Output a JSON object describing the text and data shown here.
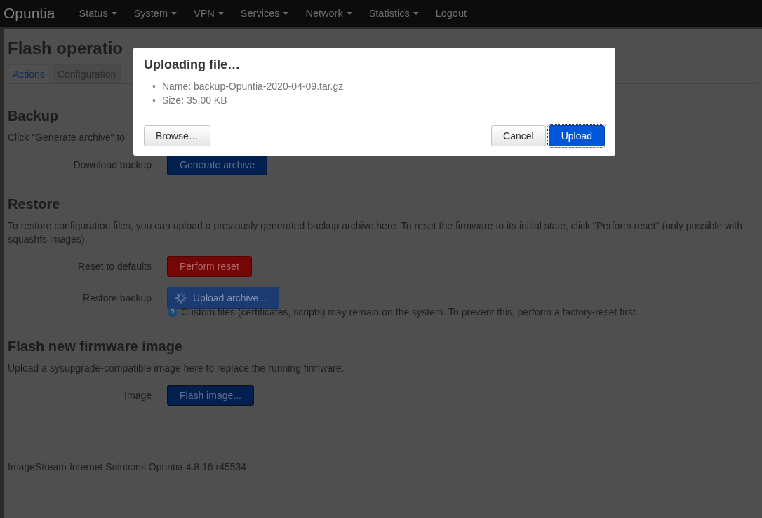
{
  "navbar": {
    "brand": "Opuntia",
    "items": [
      {
        "label": "Status",
        "dropdown": true
      },
      {
        "label": "System",
        "dropdown": true
      },
      {
        "label": "VPN",
        "dropdown": true
      },
      {
        "label": "Services",
        "dropdown": true
      },
      {
        "label": "Network",
        "dropdown": true
      },
      {
        "label": "Statistics",
        "dropdown": true
      },
      {
        "label": "Logout",
        "dropdown": false
      }
    ]
  },
  "page": {
    "title": "Flash operatio",
    "tabs": [
      {
        "label": "Actions",
        "selected": true
      },
      {
        "label": "Configuration",
        "selected": false
      }
    ],
    "sections": [
      {
        "title": "Backup",
        "description": "Click \"Generate archive\" to",
        "rows": [
          {
            "label": "Download backup",
            "button": {
              "label": "Generate archive",
              "kind": "primary"
            }
          }
        ]
      },
      {
        "title": "Restore",
        "description": "To restore configuration files, you can upload a previously generated backup archive here. To reset the firmware to its initial state, click \"Perform reset\" (only possible with squashfs images).",
        "rows": [
          {
            "label": "Reset to defaults",
            "button": {
              "label": "Perform reset",
              "kind": "danger"
            }
          },
          {
            "label": "Restore backup",
            "button": {
              "label": "Upload archive...",
              "kind": "busy"
            },
            "note": "Custom files (certificates, scripts) may remain on the system. To prevent this, perform a factory-reset first."
          }
        ]
      },
      {
        "title": "Flash new firmware image",
        "description": "Upload a sysupgrade-compatible image here to replace the running firmware.",
        "rows": [
          {
            "label": "Image",
            "button": {
              "label": "Flash image...",
              "kind": "primary"
            }
          }
        ]
      }
    ],
    "footer": "ImageStream Internet Solutions Opuntia 4.8.16 r45534"
  },
  "modal": {
    "title": "Uploading file…",
    "items": [
      {
        "marker": "•",
        "text": "Name: backup-Opuntia-2020-04-09.tar.gz"
      },
      {
        "marker": "•",
        "text": "Size: 35.00 KB"
      }
    ],
    "buttons": [
      {
        "label": "Browse…",
        "kind": "default",
        "focused": false
      },
      {
        "label": "Cancel",
        "kind": "default",
        "focused": false
      },
      {
        "label": "Upload",
        "kind": "primary",
        "focused": true
      }
    ]
  }
}
